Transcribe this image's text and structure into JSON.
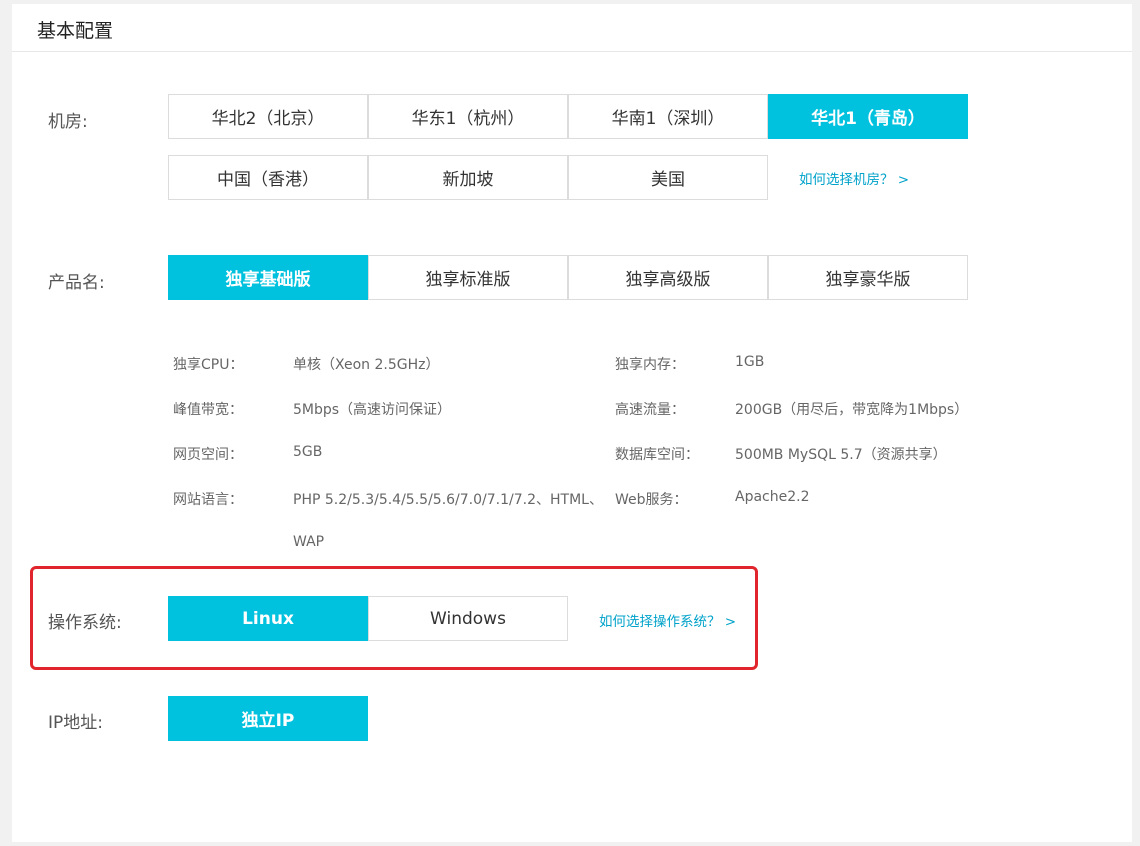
{
  "panel": {
    "title": "基本配置"
  },
  "region": {
    "label": "机房:",
    "options": [
      "华北2（北京）",
      "华东1（杭州）",
      "华南1（深圳）",
      "华北1（青岛）",
      "中国（香港）",
      "新加坡",
      "美国"
    ],
    "selected": "华北1（青岛）",
    "help": "如何选择机房？ >"
  },
  "product": {
    "label": "产品名:",
    "options": [
      "独享基础版",
      "独享标准版",
      "独享高级版",
      "独享豪华版"
    ],
    "selected": "独享基础版"
  },
  "specs": {
    "cpu_label": "独享CPU：",
    "cpu_value": "单核（Xeon 2.5GHz）",
    "mem_label": "独享内存：",
    "mem_value": "1GB",
    "bw_label": "峰值带宽：",
    "bw_value": "5Mbps（高速访问保证）",
    "traffic_label": "高速流量：",
    "traffic_value": "200GB（用尽后，带宽降为1Mbps）",
    "space_label": "网页空间：",
    "space_value": "5GB",
    "db_label": "数据库空间：",
    "db_value": "500MB MySQL 5.7（资源共享）",
    "lang_label": "网站语言：",
    "lang_value_1": "PHP 5.2/5.3/5.4/5.5/5.6/7.0/7.1/7.2、HTML、",
    "lang_value_2": "WAP",
    "web_label": "Web服务：",
    "web_value": "Apache2.2"
  },
  "os": {
    "label": "操作系统:",
    "options": [
      "Linux",
      "Windows"
    ],
    "selected": "Linux",
    "help": "如何选择操作系统？ >"
  },
  "ip": {
    "label": "IP地址:",
    "options": [
      "独立IP"
    ],
    "selected": "独立IP"
  },
  "colors": {
    "accent": "#00c1de",
    "link": "#00a2ca",
    "highlight": "#e0262c"
  }
}
